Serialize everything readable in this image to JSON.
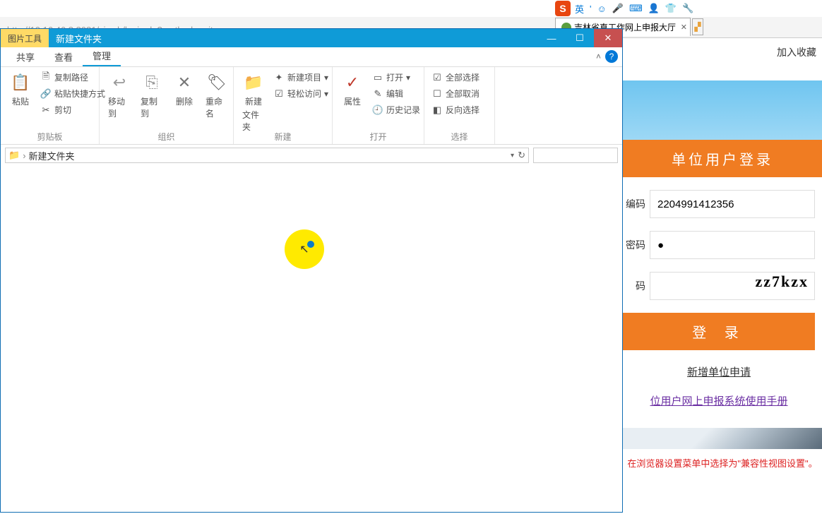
{
  "ime": {
    "lang": "英",
    "sep": "'",
    "icons": [
      "☺",
      "🎤",
      "⌨",
      "👤",
      "👕",
      "🔧"
    ]
  },
  "browser": {
    "addr_hint": "http://10.16.46.8:8081/siweb/login.do?method=unit",
    "tab_title": "吉林省直工作网上申报大厅"
  },
  "explorer": {
    "title_tab_tool": "图片工具",
    "title_tab_name": "新建文件夹",
    "tabs": {
      "share": "共享",
      "view": "查看",
      "manage": "管理"
    },
    "ribbon": {
      "clipboard": {
        "label": "剪贴板",
        "paste": "粘贴",
        "copy_path": "复制路径",
        "paste_shortcut": "粘贴快捷方式",
        "cut": "剪切"
      },
      "organize": {
        "label": "组织",
        "move_to": "移动到",
        "copy_to": "复制到",
        "delete": "删除",
        "rename": "重命名"
      },
      "new": {
        "label": "新建",
        "new_folder": "新建文件夹",
        "new_folder_short": "新建",
        "new_item": "新建项目",
        "easy_access": "轻松访问"
      },
      "open": {
        "label": "打开",
        "properties": "属性",
        "open": "打开",
        "edit": "编辑",
        "history": "历史记录"
      },
      "select": {
        "label": "选择",
        "select_all": "全部选择",
        "select_none": "全部取消",
        "invert": "反向选择"
      }
    },
    "breadcrumb": "新建文件夹"
  },
  "login": {
    "favorite": "加入收藏",
    "title": "单位用户登录",
    "code_label": "编码",
    "code_value": "2204991412356",
    "pwd_label": "密码",
    "pwd_value": "●",
    "captcha_label": "码",
    "captcha_text": "zz7kzx",
    "submit": "登  录",
    "new_unit": "新增单位申请",
    "manual": "位用户网上申报系统使用手册",
    "compat": "在浏览器设置菜单中选择为\"兼容性视图设置\"。"
  }
}
